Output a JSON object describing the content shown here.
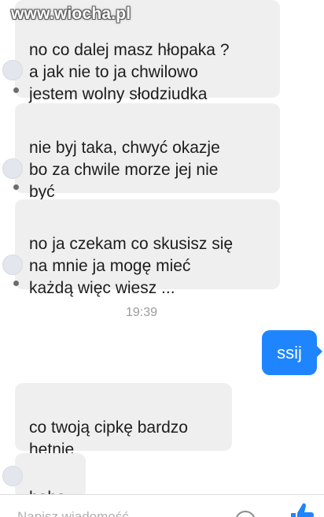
{
  "watermark": "www.wiocha.pl",
  "messages_before": [
    {
      "text": "no co dalej masz hłopaka ?\na jak nie to ja chwilowo\njestem wolny słodziudka"
    },
    {
      "text": "nie byj taka, chwyć okazje\nbo za chwile morze jej nie\nbyć"
    },
    {
      "text": "no ja czekam co skusisz się\nna mnie ja mogę mieć\nkażdą więc wiesz ..."
    }
  ],
  "timestamp": "19:39",
  "sent_message": "ssij",
  "messages_after": [
    {
      "text": "co twoją cipkę bardzo\nhętnie"
    },
    {
      "text": "haha"
    }
  ],
  "composer": {
    "placeholder": "Napisz wiadomość..."
  },
  "icons": {
    "camera": "circle-icon",
    "like": "thumbs-up-icon"
  },
  "colors": {
    "incoming_bubble": "#efefef",
    "outgoing_bubble": "#1f85ff",
    "timestamp": "#9b9b9b"
  }
}
